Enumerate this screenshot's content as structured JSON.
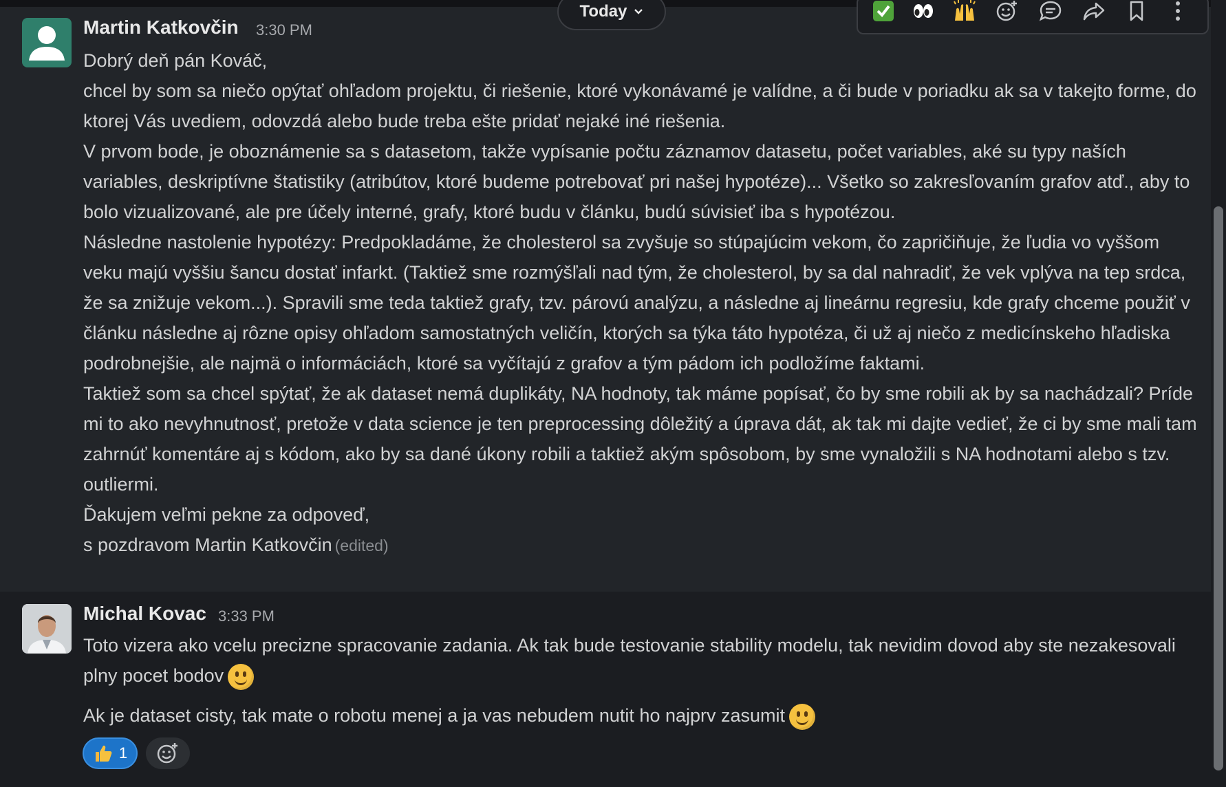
{
  "divider": {
    "label": "Today"
  },
  "messages": [
    {
      "sender": "Martin Katkovčin",
      "time": "3:30 PM",
      "paragraphs": [
        "Dobrý deň pán Kováč,",
        "chcel by som sa niečo opýtať ohľadom projektu, či riešenie, ktoré vykonávamé je valídne, a či bude v poriadku ak sa v takejto forme,  do ktorej Vás uvediem, odovzdá alebo bude treba ešte pridať nejaké iné riešenia.",
        "V prvom bode, je oboznámenie sa s datasetom, takže vypísanie počtu záznamov datasetu, počet variables, aké su typy naších variables, deskriptívne štatistiky (atribútov, ktoré budeme potrebovať pri našej hypotéze)... Všetko so zakresľovaním grafov atď., aby to bolo vizualizované, ale pre účely interné, grafy, ktoré budu v článku, budú súvisieť iba s hypotézou.",
        "Následne nastolenie hypotézy: Predpokladáme, že cholesterol sa zvyšuje so stúpajúcim vekom, čo zapričiňuje, že ľudia vo vyššom veku majú vyššiu šancu dostať infarkt. (Taktiež sme rozmýšľali nad tým, že cholesterol, by sa dal nahradiť, že vek vplýva na tep srdca, že sa znižuje vekom...). Spravili sme teda taktiež grafy, tzv. párovú analýzu, a následne aj lineárnu regresiu, kde grafy chceme použiť v článku následne aj rôzne opisy ohľadom samostatných veličín, ktorých sa týka táto hypotéza, či už aj niečo z medicínskeho hľadiska podrobnejšie, ale najmä o informáciách, ktoré sa vyčítajú z grafov a tým pádom ich podložíme faktami.",
        "Taktiež som sa chcel spýtať, že ak dataset nemá duplikáty, NA hodnoty, tak máme popísať, čo by sme robili ak by sa nachádzali? Príde mi to ako nevyhnutnosť, pretože v data science je ten preprocessing dôležitý a úprava dát, ak tak mi dajte vedieť, že ci by sme mali tam zahrnúť komentáre aj s kódom, ako by sa dané úkony robili a taktiež akým spôsobom, by sme vynaložili s NA hodnotami alebo s tzv. outliermi.",
        "Ďakujem veľmi pekne za odpoveď,",
        "s pozdravom Martin Katkovčin"
      ],
      "edited_label": "(edited)"
    },
    {
      "sender": "Michal Kovac",
      "time": "3:33 PM",
      "paragraphs": [
        "Toto vizera ako vcelu precizne spracovanie zadania. Ak tak bude testovanie stability modelu, tak nevidim dovod aby ste nezakesovali plny pocet bodov",
        "Ak je dataset cisty, tak mate o robotu menej a ja vas nebudem nutit ho najprv zasumit"
      ],
      "reactions": [
        {
          "emoji": "thumbs-up",
          "count": "1"
        }
      ]
    }
  ],
  "toolbar_icons": [
    "check-mark-emoji",
    "eyes-emoji",
    "raised-hands-emoji",
    "add-reaction-icon",
    "reply-in-thread-icon",
    "share-icon",
    "bookmark-icon",
    "more-actions-icon"
  ],
  "colors": {
    "background": "#1b1d21",
    "hover_bg": "#222529",
    "text": "#d1d2d3",
    "reaction_blue": "#1d74c9"
  }
}
